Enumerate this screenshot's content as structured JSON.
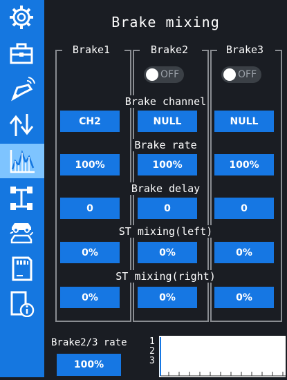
{
  "title": "Brake mixing",
  "columns": [
    {
      "label": "Brake1"
    },
    {
      "label": "Brake2",
      "toggle": "OFF"
    },
    {
      "label": "Brake3",
      "toggle": "OFF"
    }
  ],
  "sections": [
    {
      "label": "Brake channel",
      "values": [
        "CH2",
        "NULL",
        "NULL"
      ]
    },
    {
      "label": "Brake rate",
      "values": [
        "100%",
        "100%",
        "100%"
      ]
    },
    {
      "label": "Brake delay",
      "values": [
        "0",
        "0",
        "0"
      ]
    },
    {
      "label": "ST mixing(left)",
      "values": [
        "0%",
        "0%",
        "0%"
      ]
    },
    {
      "label": "ST mixing(right)",
      "values": [
        "0%",
        "0%",
        "0%"
      ]
    }
  ],
  "footer": {
    "label": "Brake2/3 rate",
    "value": "100%",
    "curve_labels": [
      "1",
      "2",
      "3"
    ]
  },
  "sidebar": [
    "gear-icon",
    "toolbox-icon",
    "transmitter-icon",
    "channel-reverse-icon",
    "mixing-chart-icon",
    "chassis-icon",
    "cars-swap-icon",
    "sd-card-icon",
    "info-doc-icon"
  ],
  "colors": {
    "accent": "#1677e3",
    "sidebar": "#1577e0",
    "active": "#7ec4ff",
    "background": "#1a1d23"
  }
}
